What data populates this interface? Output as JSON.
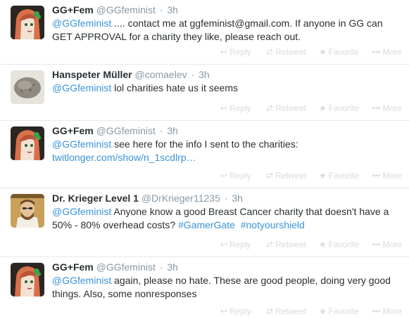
{
  "tweets": [
    {
      "name": "GG+Fem",
      "handle": "@GGfeminist",
      "time": "3h",
      "mention": "@GGfeminist",
      "text_after": " .... contact me at ggfeminist@gmail.com.  If anyone in GG can GET APPROVAL for a charity they like, please reach out.",
      "avatar": "green-haired-woman"
    },
    {
      "name": "Hanspeter Müller",
      "handle": "@comaelev",
      "time": "3h",
      "mention": "@GGfeminist",
      "text_after": " lol charities hate us it seems",
      "avatar": "grey-rock"
    },
    {
      "name": "GG+Fem",
      "handle": "@GGfeminist",
      "time": "3h",
      "mention": "@GGfeminist",
      "text_after": " see here for the info I sent to the charities:",
      "link": "twitlonger.com/show/n_1scdlrp…",
      "avatar": "green-haired-woman"
    },
    {
      "name": "Dr. Krieger Level 1",
      "handle": "@DrKrieger11235",
      "time": "3h",
      "mention": "@GGfeminist",
      "text_after": " Anyone know a good Breast Cancer charity that doesn't have a 50% - 80% overhead costs?",
      "hashtag1": "#GamerGate",
      "hashtag2": "#notyourshield",
      "avatar": "bearded-doctor"
    },
    {
      "name": "GG+Fem",
      "handle": "@GGfeminist",
      "time": "3h",
      "mention": "@GGfeminist",
      "text_after": " again, please no hate.  These are good people, doing very good things.  Also, some nonresponses",
      "avatar": "green-haired-woman"
    }
  ],
  "actions": {
    "reply": "Reply",
    "retweet": "Retweet",
    "favorite": "Favorite",
    "more": "More"
  },
  "separator": "·",
  "icons": {
    "reply": "reply-icon",
    "retweet": "retweet-icon",
    "favorite": "star-icon",
    "more": "more-dots-icon"
  },
  "colors": {
    "link": "#3b94d9",
    "muted": "#8899a6",
    "action": "#d7dbdd"
  }
}
